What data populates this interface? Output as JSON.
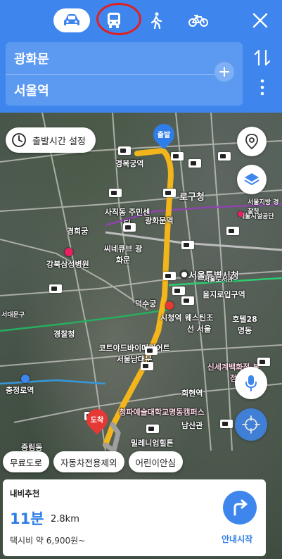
{
  "header": {
    "modes": [
      {
        "name": "car",
        "icon": "car-icon",
        "active": true
      },
      {
        "name": "transit",
        "icon": "bus-icon",
        "active": false
      },
      {
        "name": "walk",
        "icon": "walk-icon",
        "active": false
      },
      {
        "name": "bike",
        "icon": "bike-icon",
        "active": false
      }
    ],
    "origin": "광화문",
    "destination": "서울역"
  },
  "controls": {
    "depart_time_label": "출발시간 설정"
  },
  "filters": [
    "무료도로",
    "자동차전용제외",
    "어린이안심"
  ],
  "markers": {
    "start": "출발",
    "end": "도착"
  },
  "map_labels": [
    "경복궁역",
    "로구청",
    "사직동 주민센터",
    "광화문역",
    "경희궁",
    "씨네큐브 광화문",
    "강북삼성병원",
    "서울특별시청",
    "을지로입구역",
    "덕수궁",
    "시청역",
    "웨스틴조선 서울",
    "호텔28 명동",
    "서대문구",
    "경찰청",
    "신세계백화점 본점",
    "코트야드바이메리어트 서울남대문",
    "회현역",
    "충정로역",
    "청파예술대학교명동캠퍼스",
    "남산관",
    "밀레니엄힐튼",
    "중림동",
    "서울시설공단",
    "서울지방 경찰청",
    "서울도서관"
  ],
  "card": {
    "label": "내비추천",
    "duration": "11분",
    "distance": "2.8km",
    "taxi": "택시비 약 6,900원~",
    "start_label": "안내시작"
  },
  "colors": {
    "header_blue": "#3e86ee",
    "route_yellow": "#f2b51b",
    "start_marker": "#2f7de8",
    "end_marker": "#e53935",
    "annotation_red": "#e02020"
  }
}
